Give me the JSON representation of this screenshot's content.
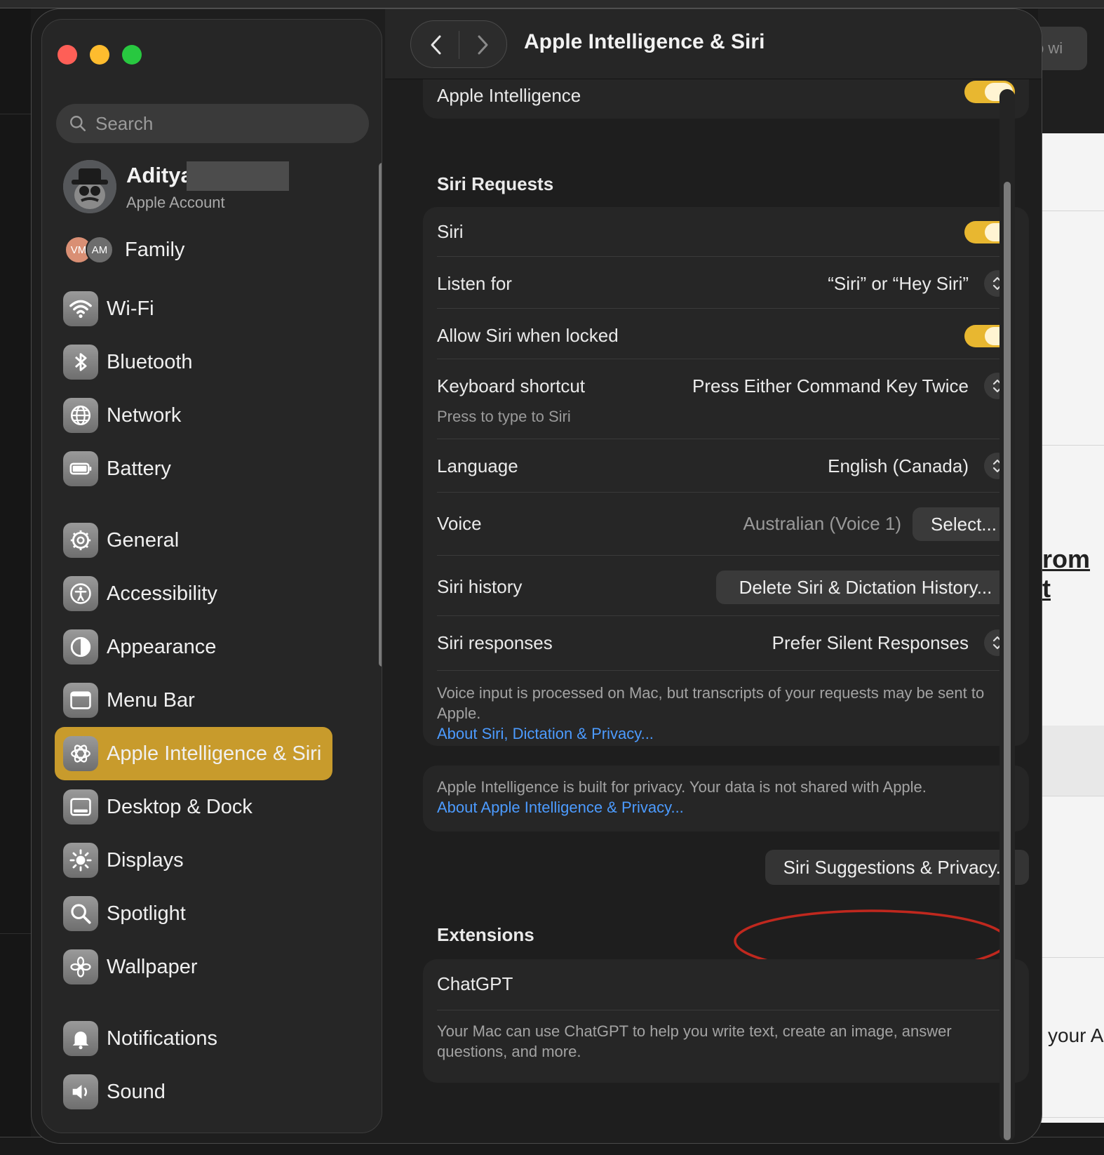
{
  "background": {
    "right_button_text": "p wi",
    "right_text_1": "rom t",
    "right_text_2": "your A"
  },
  "window": {
    "title": "Apple Intelligence & Siri"
  },
  "colors": {
    "accent_selected": "#c89b2c",
    "toggle_on": "#e8b730",
    "link": "#4c9bff",
    "highlight_circle": "#c0281e"
  },
  "sidebar": {
    "search_placeholder": "Search",
    "account": {
      "name": "Aditya",
      "subtitle": "Apple Account"
    },
    "family": {
      "label": "Family",
      "avatars": [
        "VM",
        "AM"
      ]
    },
    "items": [
      {
        "label": "Wi-Fi",
        "icon": "wifi-icon"
      },
      {
        "label": "Bluetooth",
        "icon": "bluetooth-icon"
      },
      {
        "label": "Network",
        "icon": "globe-icon"
      },
      {
        "label": "Battery",
        "icon": "battery-icon"
      },
      {
        "label": "General",
        "icon": "gear-icon"
      },
      {
        "label": "Accessibility",
        "icon": "accessibility-icon"
      },
      {
        "label": "Appearance",
        "icon": "appearance-icon"
      },
      {
        "label": "Menu Bar",
        "icon": "menubar-icon"
      },
      {
        "label": "Apple Intelligence & Siri",
        "icon": "apple-intelligence-icon",
        "selected": true
      },
      {
        "label": "Desktop & Dock",
        "icon": "dock-icon"
      },
      {
        "label": "Displays",
        "icon": "sun-icon"
      },
      {
        "label": "Spotlight",
        "icon": "magnifier-icon"
      },
      {
        "label": "Wallpaper",
        "icon": "flower-icon"
      },
      {
        "label": "Notifications",
        "icon": "bell-icon"
      },
      {
        "label": "Sound",
        "icon": "speaker-icon"
      }
    ]
  },
  "main": {
    "top_card": {
      "label": "Apple Intelligence",
      "toggle_on": true
    },
    "siri_requests": {
      "title": "Siri Requests",
      "siri": {
        "label": "Siri",
        "toggle_on": true
      },
      "listen_for": {
        "label": "Listen for",
        "value": "“Siri” or “Hey Siri”"
      },
      "allow_locked": {
        "label": "Allow Siri when locked",
        "toggle_on": true
      },
      "keyboard_shortcut": {
        "label": "Keyboard shortcut",
        "sub": "Press to type to Siri",
        "value": "Press Either Command Key Twice"
      },
      "language": {
        "label": "Language",
        "value": "English (Canada)"
      },
      "voice": {
        "label": "Voice",
        "value": "Australian (Voice 1)",
        "button": "Select..."
      },
      "siri_history": {
        "label": "Siri history",
        "button": "Delete Siri & Dictation History..."
      },
      "siri_responses": {
        "label": "Siri responses",
        "value": "Prefer Silent Responses"
      },
      "note": "Voice input is processed on Mac, but transcripts of your requests may be sent to Apple.",
      "note_link": "About Siri, Dictation & Privacy..."
    },
    "privacy": {
      "note": "Apple Intelligence is built for privacy. Your data is not shared with Apple.",
      "note_link": "About Apple Intelligence & Privacy..."
    },
    "suggestions_button": "Siri Suggestions & Privacy...",
    "extensions": {
      "title": "Extensions",
      "chatgpt": {
        "label": "ChatGPT"
      },
      "note": "Your Mac can use ChatGPT to help you write text, create an image, answer questions, and more."
    }
  }
}
